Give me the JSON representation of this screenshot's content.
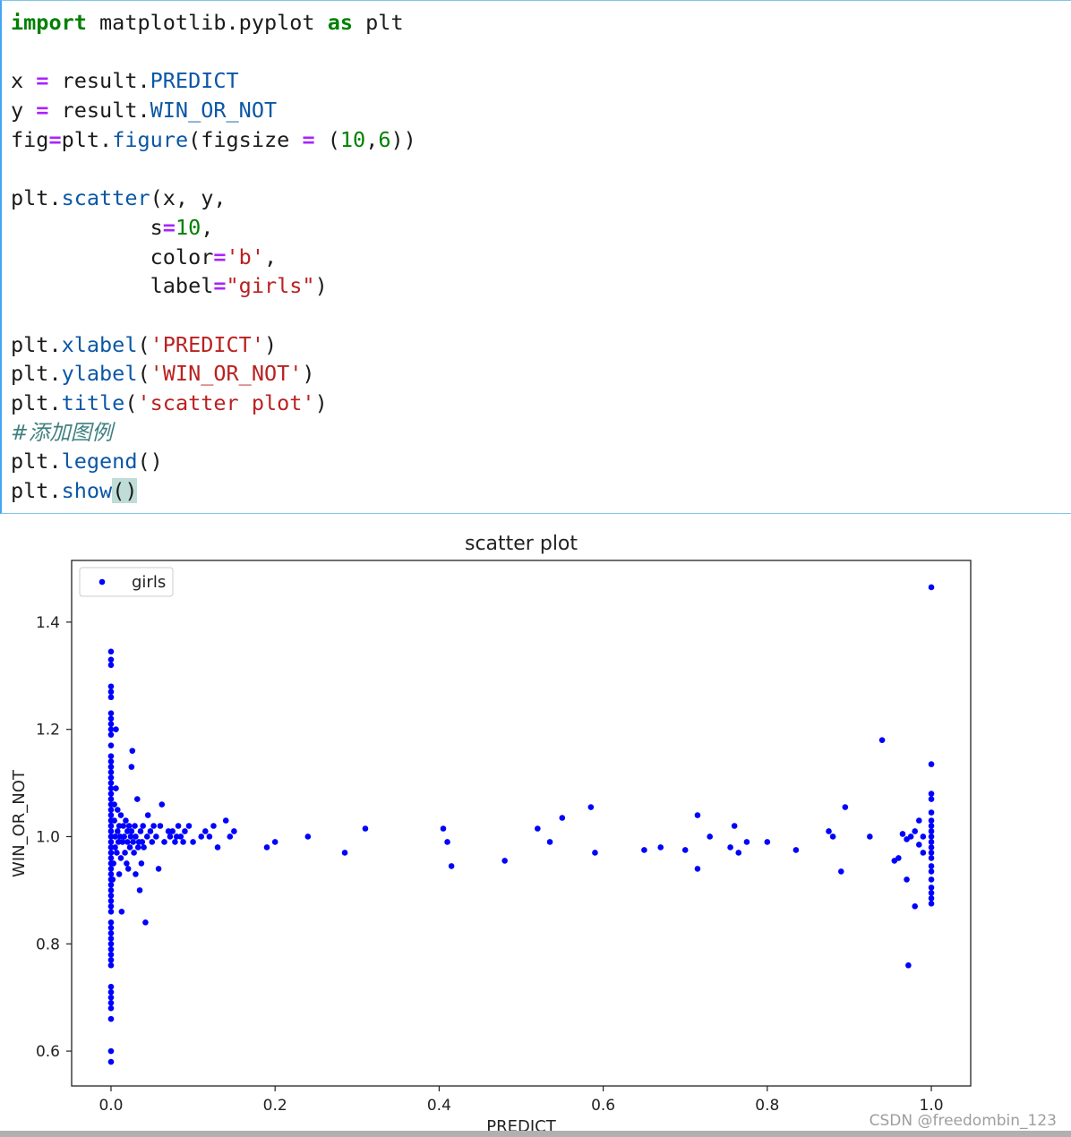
{
  "code": {
    "lines": [
      [
        [
          "kw",
          "import"
        ],
        [
          "plain",
          " matplotlib.pyplot "
        ],
        [
          "kw",
          "as"
        ],
        [
          "plain",
          " plt"
        ]
      ],
      [],
      [
        [
          "plain",
          "x "
        ],
        [
          "op",
          "="
        ],
        [
          "plain",
          " result."
        ],
        [
          "attr",
          "PREDICT"
        ]
      ],
      [
        [
          "plain",
          "y "
        ],
        [
          "op",
          "="
        ],
        [
          "plain",
          " result."
        ],
        [
          "attr",
          "WIN_OR_NOT"
        ]
      ],
      [
        [
          "plain",
          "fig"
        ],
        [
          "op",
          "="
        ],
        [
          "plain",
          "plt."
        ],
        [
          "attr",
          "figure"
        ],
        [
          "plain",
          "(figsize "
        ],
        [
          "op",
          "="
        ],
        [
          "plain",
          " ("
        ],
        [
          "num",
          "10"
        ],
        [
          "plain",
          ","
        ],
        [
          "num",
          "6"
        ],
        [
          "plain",
          "))"
        ]
      ],
      [],
      [
        [
          "plain",
          "plt."
        ],
        [
          "attr",
          "scatter"
        ],
        [
          "plain",
          "(x, y,"
        ]
      ],
      [
        [
          "plain",
          "           s"
        ],
        [
          "op",
          "="
        ],
        [
          "num",
          "10"
        ],
        [
          "plain",
          ","
        ]
      ],
      [
        [
          "plain",
          "           color"
        ],
        [
          "op",
          "="
        ],
        [
          "str",
          "'b'"
        ],
        [
          "plain",
          ","
        ]
      ],
      [
        [
          "plain",
          "           label"
        ],
        [
          "op",
          "="
        ],
        [
          "str",
          "\"girls\""
        ],
        [
          "plain",
          ")"
        ]
      ],
      [],
      [
        [
          "plain",
          "plt."
        ],
        [
          "attr",
          "xlabel"
        ],
        [
          "plain",
          "("
        ],
        [
          "str",
          "'PREDICT'"
        ],
        [
          "plain",
          ")"
        ]
      ],
      [
        [
          "plain",
          "plt."
        ],
        [
          "attr",
          "ylabel"
        ],
        [
          "plain",
          "("
        ],
        [
          "str",
          "'WIN_OR_NOT'"
        ],
        [
          "plain",
          ")"
        ]
      ],
      [
        [
          "plain",
          "plt."
        ],
        [
          "attr",
          "title"
        ],
        [
          "plain",
          "("
        ],
        [
          "str",
          "'scatter plot'"
        ],
        [
          "plain",
          ")"
        ]
      ],
      [
        [
          "cmt",
          "#添加图例"
        ]
      ],
      [
        [
          "plain",
          "plt."
        ],
        [
          "attr",
          "legend"
        ],
        [
          "plain",
          "()"
        ]
      ],
      [
        [
          "plain",
          "plt."
        ],
        [
          "attr",
          "show"
        ],
        [
          "hl",
          "()"
        ]
      ]
    ]
  },
  "chart_data": {
    "type": "scatter",
    "title": "scatter plot",
    "xlabel": "PREDICT",
    "ylabel": "WIN_OR_NOT",
    "xlim": [
      -0.048,
      1.048
    ],
    "ylim": [
      0.535,
      1.515
    ],
    "xticks": [
      {
        "value": 0.0,
        "label": "0.0"
      },
      {
        "value": 0.2,
        "label": "0.2"
      },
      {
        "value": 0.4,
        "label": "0.4"
      },
      {
        "value": 0.6,
        "label": "0.6"
      },
      {
        "value": 0.8,
        "label": "0.8"
      },
      {
        "value": 1.0,
        "label": "1.0"
      }
    ],
    "yticks": [
      {
        "value": 0.6,
        "label": "0.6"
      },
      {
        "value": 0.8,
        "label": "0.8"
      },
      {
        "value": 1.0,
        "label": "1.0"
      },
      {
        "value": 1.2,
        "label": "1.2"
      },
      {
        "value": 1.4,
        "label": "1.4"
      }
    ],
    "grid": false,
    "legend": {
      "placement": "upper-left",
      "entries": [
        "girls"
      ]
    },
    "series": [
      {
        "name": "girls",
        "color": "#0000ff",
        "marker_size": 10,
        "points": [
          [
            0,
            0.58
          ],
          [
            0,
            0.6
          ],
          [
            0,
            0.66
          ],
          [
            0,
            0.68
          ],
          [
            0,
            0.69
          ],
          [
            0,
            0.7
          ],
          [
            0,
            0.71
          ],
          [
            0,
            0.72
          ],
          [
            0,
            0.76
          ],
          [
            0,
            0.77
          ],
          [
            0,
            0.78
          ],
          [
            0,
            0.79
          ],
          [
            0,
            0.8
          ],
          [
            0,
            0.81
          ],
          [
            0,
            0.82
          ],
          [
            0,
            0.83
          ],
          [
            0,
            0.84
          ],
          [
            0,
            0.86
          ],
          [
            0,
            0.87
          ],
          [
            0,
            0.88
          ],
          [
            0,
            0.89
          ],
          [
            0,
            0.9
          ],
          [
            0,
            0.91
          ],
          [
            0,
            0.92
          ],
          [
            0,
            0.93
          ],
          [
            0,
            0.94
          ],
          [
            0,
            0.95
          ],
          [
            0,
            0.96
          ],
          [
            0,
            0.97
          ],
          [
            0,
            0.98
          ],
          [
            0,
            0.99
          ],
          [
            0,
            1.0
          ],
          [
            0,
            1.01
          ],
          [
            0,
            1.02
          ],
          [
            0,
            1.03
          ],
          [
            0,
            1.04
          ],
          [
            0,
            1.05
          ],
          [
            0,
            1.06
          ],
          [
            0,
            1.07
          ],
          [
            0,
            1.08
          ],
          [
            0,
            1.09
          ],
          [
            0,
            1.1
          ],
          [
            0,
            1.11
          ],
          [
            0,
            1.12
          ],
          [
            0,
            1.13
          ],
          [
            0,
            1.14
          ],
          [
            0,
            1.15
          ],
          [
            0,
            1.17
          ],
          [
            0,
            1.19
          ],
          [
            0,
            1.2
          ],
          [
            0,
            1.21
          ],
          [
            0,
            1.22
          ],
          [
            0,
            1.23
          ],
          [
            0,
            1.26
          ],
          [
            0,
            1.27
          ],
          [
            0,
            1.28
          ],
          [
            0,
            1.32
          ],
          [
            0,
            1.33
          ],
          [
            0,
            1.345
          ],
          [
            0.002,
            0.92
          ],
          [
            0.003,
            0.95
          ],
          [
            0.004,
            1.03
          ],
          [
            0.004,
            1.06
          ],
          [
            0.005,
            0.98
          ],
          [
            0.005,
            1.0
          ],
          [
            0.006,
            1.09
          ],
          [
            0.006,
            1.2
          ],
          [
            0.007,
            0.97
          ],
          [
            0.008,
            1.01
          ],
          [
            0.008,
            1.05
          ],
          [
            0.009,
            0.99
          ],
          [
            0.01,
            1.02
          ],
          [
            0.01,
            0.93
          ],
          [
            0.011,
            1.0
          ],
          [
            0.012,
            0.96
          ],
          [
            0.012,
            1.04
          ],
          [
            0.013,
            0.86
          ],
          [
            0.014,
            0.99
          ],
          [
            0.015,
            1.02
          ],
          [
            0.016,
            1.0
          ],
          [
            0.017,
            0.97
          ],
          [
            0.018,
            1.03
          ],
          [
            0.019,
            0.95
          ],
          [
            0.02,
            1.01
          ],
          [
            0.02,
            0.99
          ],
          [
            0.021,
            0.94
          ],
          [
            0.022,
            1.02
          ],
          [
            0.023,
            0.98
          ],
          [
            0.024,
            1.0
          ],
          [
            0.025,
            1.13
          ],
          [
            0.025,
            1.01
          ],
          [
            0.026,
            1.16
          ],
          [
            0.027,
            0.99
          ],
          [
            0.028,
            0.97
          ],
          [
            0.029,
            1.02
          ],
          [
            0.03,
            1.0
          ],
          [
            0.03,
            0.93
          ],
          [
            0.032,
            1.07
          ],
          [
            0.033,
            0.98
          ],
          [
            0.034,
            0.99
          ],
          [
            0.035,
            0.9
          ],
          [
            0.036,
            1.01
          ],
          [
            0.037,
            0.95
          ],
          [
            0.038,
            0.99
          ],
          [
            0.039,
            1.02
          ],
          [
            0.04,
            0.98
          ],
          [
            0.042,
            0.84
          ],
          [
            0.044,
            1.0
          ],
          [
            0.045,
            1.04
          ],
          [
            0.048,
            1.01
          ],
          [
            0.05,
            0.99
          ],
          [
            0.052,
            1.02
          ],
          [
            0.055,
            1.0
          ],
          [
            0.058,
            0.94
          ],
          [
            0.06,
            1.02
          ],
          [
            0.062,
            1.06
          ],
          [
            0.065,
            0.99
          ],
          [
            0.07,
            1.01
          ],
          [
            0.072,
            1.0
          ],
          [
            0.075,
            1.01
          ],
          [
            0.078,
            0.99
          ],
          [
            0.08,
            1.0
          ],
          [
            0.082,
            1.02
          ],
          [
            0.085,
            1.0
          ],
          [
            0.088,
            0.99
          ],
          [
            0.09,
            1.01
          ],
          [
            0.095,
            1.02
          ],
          [
            0.1,
            0.99
          ],
          [
            0.11,
            1.0
          ],
          [
            0.115,
            1.01
          ],
          [
            0.12,
            1.0
          ],
          [
            0.125,
            1.02
          ],
          [
            0.13,
            0.98
          ],
          [
            0.14,
            1.03
          ],
          [
            0.145,
            1.0
          ],
          [
            0.15,
            1.01
          ],
          [
            0.19,
            0.98
          ],
          [
            0.2,
            0.99
          ],
          [
            0.24,
            1.0
          ],
          [
            0.285,
            0.97
          ],
          [
            0.31,
            1.015
          ],
          [
            0.405,
            1.015
          ],
          [
            0.41,
            0.99
          ],
          [
            0.415,
            0.945
          ],
          [
            0.48,
            0.955
          ],
          [
            0.52,
            1.015
          ],
          [
            0.535,
            0.99
          ],
          [
            0.55,
            1.035
          ],
          [
            0.585,
            1.055
          ],
          [
            0.59,
            0.97
          ],
          [
            0.65,
            0.975
          ],
          [
            0.67,
            0.98
          ],
          [
            0.7,
            0.975
          ],
          [
            0.715,
            0.94
          ],
          [
            0.715,
            1.04
          ],
          [
            0.73,
            1.0
          ],
          [
            0.755,
            0.98
          ],
          [
            0.76,
            1.02
          ],
          [
            0.765,
            0.97
          ],
          [
            0.775,
            0.99
          ],
          [
            0.8,
            0.99
          ],
          [
            0.835,
            0.975
          ],
          [
            0.875,
            1.01
          ],
          [
            0.88,
            1.0
          ],
          [
            0.89,
            0.935
          ],
          [
            0.895,
            1.055
          ],
          [
            0.925,
            1.0
          ],
          [
            0.94,
            1.18
          ],
          [
            0.955,
            0.955
          ],
          [
            0.96,
            0.96
          ],
          [
            0.965,
            1.005
          ],
          [
            0.97,
            0.995
          ],
          [
            0.97,
            0.92
          ],
          [
            0.972,
            0.76
          ],
          [
            0.975,
            1.0
          ],
          [
            0.98,
            0.87
          ],
          [
            0.98,
            1.01
          ],
          [
            0.985,
            1.03
          ],
          [
            0.985,
            0.985
          ],
          [
            0.99,
            1.0
          ],
          [
            0.99,
            0.97
          ],
          [
            1.0,
            0.875
          ],
          [
            1.0,
            0.885
          ],
          [
            1.0,
            0.895
          ],
          [
            1.0,
            0.905
          ],
          [
            1.0,
            0.92
          ],
          [
            1.0,
            0.935
          ],
          [
            1.0,
            0.945
          ],
          [
            1.0,
            0.96
          ],
          [
            1.0,
            0.97
          ],
          [
            1.0,
            0.98
          ],
          [
            1.0,
            0.99
          ],
          [
            1.0,
            1.0
          ],
          [
            1.0,
            1.01
          ],
          [
            1.0,
            1.02
          ],
          [
            1.0,
            1.03
          ],
          [
            1.0,
            1.045
          ],
          [
            1.0,
            1.07
          ],
          [
            1.0,
            1.08
          ],
          [
            1.0,
            1.135
          ],
          [
            1.0,
            1.465
          ]
        ]
      }
    ]
  },
  "watermark": "CSDN @freedombin_123"
}
